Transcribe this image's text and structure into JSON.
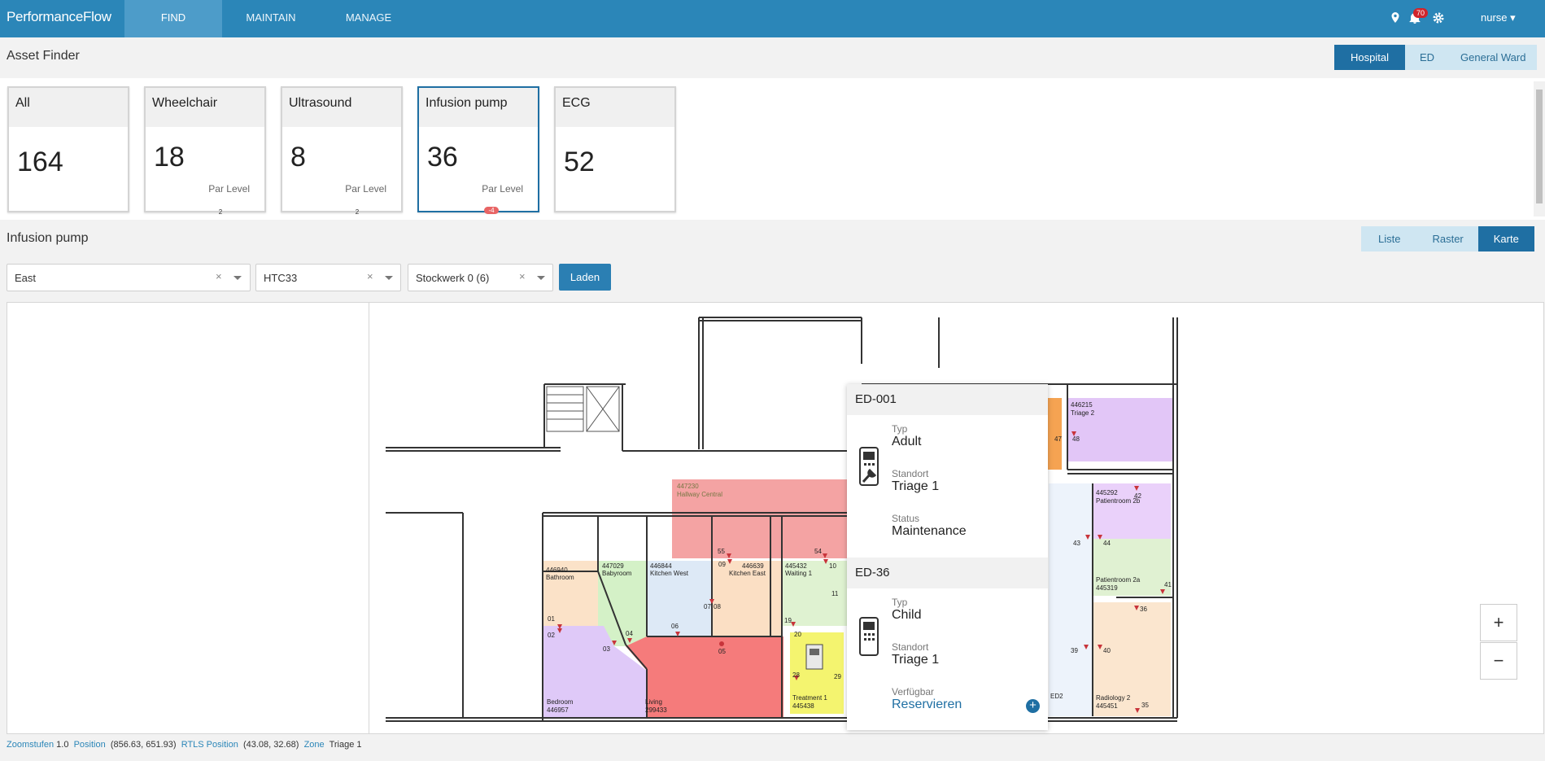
{
  "navbar": {
    "brand": "PerformanceFlow",
    "tabs": [
      {
        "label": "FIND",
        "active": true
      },
      {
        "label": "MAINTAIN",
        "active": false
      },
      {
        "label": "MANAGE",
        "active": false
      }
    ],
    "notification_count": "70",
    "user": "nurse ▾",
    "icons": [
      "location-pin-icon",
      "bell-icon",
      "gear-icon"
    ],
    "color": "#2b86b8"
  },
  "asset_finder": {
    "title": "Asset Finder",
    "scope_buttons": [
      {
        "label": "Hospital",
        "active": true
      },
      {
        "label": "ED",
        "active": false
      },
      {
        "label": "General Ward",
        "active": false
      }
    ]
  },
  "cards": [
    {
      "name": "All",
      "count": "164",
      "par_label": "",
      "par_value": ""
    },
    {
      "name": "Wheelchair",
      "count": "18",
      "par_label": "Par Level",
      "par_value": "2"
    },
    {
      "name": "Ultrasound",
      "count": "8",
      "par_label": "Par Level",
      "par_value": "2"
    },
    {
      "name": "Infusion pump",
      "count": "36",
      "par_label": "Par Level",
      "par_value": "-4",
      "selected": true
    },
    {
      "name": "ECG",
      "count": "52",
      "par_label": "",
      "par_value": ""
    }
  ],
  "detail": {
    "title": "Infusion pump",
    "view_buttons": [
      {
        "label": "Liste",
        "active": false
      },
      {
        "label": "Raster",
        "active": false
      },
      {
        "label": "Karte",
        "active": true
      }
    ]
  },
  "filters": {
    "building": "East",
    "section": "HTC33",
    "floor": "Stockwerk 0 (6)",
    "clear": "×",
    "load_label": "Laden"
  },
  "map": {
    "rooms": [
      {
        "id": "447230",
        "name": "Hallway Central"
      },
      {
        "id": "446940",
        "name": "Bathroom"
      },
      {
        "id": "447029",
        "name": "Babyroom"
      },
      {
        "id": "446844",
        "name": "Kitchen West"
      },
      {
        "id": "446639",
        "name": "Kitchen East"
      },
      {
        "id": "445432",
        "name": "Waiting 1"
      },
      {
        "id": "446957",
        "name": "Bedroom"
      },
      {
        "id": "299433",
        "name": "Living"
      },
      {
        "id": "445438",
        "name": "Treatment 1"
      },
      {
        "id": "446215",
        "name": "Triage 2"
      },
      {
        "id": "445292",
        "name": "Patientroom 2b"
      },
      {
        "id": "445319",
        "name": "Patientroom 2a"
      },
      {
        "id": "445451",
        "name": "Radiology 2"
      },
      {
        "id": "",
        "name": "ED2"
      }
    ],
    "markers": [
      "01",
      "02",
      "03",
      "04",
      "05",
      "06",
      "07",
      "08",
      "09",
      "10",
      "11",
      "19",
      "20",
      "28",
      "29",
      "35",
      "36",
      "39",
      "40",
      "41",
      "42",
      "43",
      "44",
      "47",
      "48",
      "54",
      "55"
    ],
    "zoom_in": "+",
    "zoom_out": "−"
  },
  "popup": {
    "assets": [
      {
        "id": "ED-001",
        "fields": [
          {
            "label": "Typ",
            "value": "Adult"
          },
          {
            "label": "Standort",
            "value": "Triage 1"
          },
          {
            "label": "Status",
            "value": "Maintenance"
          }
        ],
        "icon": "infusion-pump-maintenance-icon"
      },
      {
        "id": "ED-36",
        "fields": [
          {
            "label": "Typ",
            "value": "Child"
          },
          {
            "label": "Standort",
            "value": "Triage 1"
          },
          {
            "label": "Verfügbar",
            "value": "Reservieren"
          }
        ],
        "icon": "infusion-pump-icon"
      }
    ]
  },
  "statusbar": {
    "zoom_label": "Zoomstufen",
    "zoom_value": "1.0",
    "position_label": "Position",
    "position_value": "(856.63, 651.93)",
    "rtls_label": "RTLS Position",
    "rtls_value": "(43.08, 32.68)",
    "zone_label": "Zone",
    "zone_value": "Triage 1"
  }
}
